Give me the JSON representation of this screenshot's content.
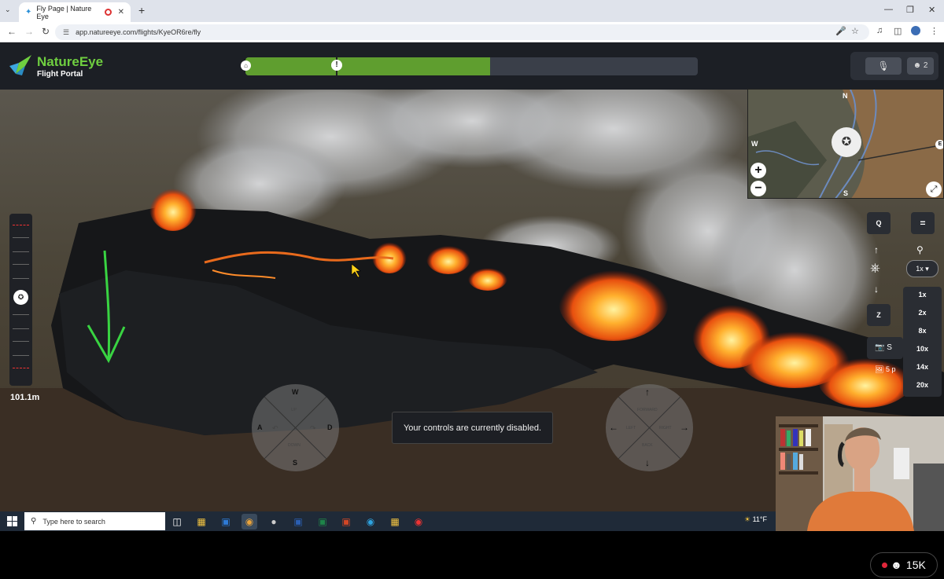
{
  "browser": {
    "tab_title": "Fly Page | Nature Eye",
    "url": "app.natureeye.com/flights/KyeOR6re/fly"
  },
  "header": {
    "brand": "NatureEye",
    "subtitle": "Flight Portal",
    "flight_progress": 0.54,
    "viewers_in_session": "2"
  },
  "flight": {
    "altitude": "101.1m",
    "controls_disabled_message": "Your controls are currently disabled."
  },
  "left_joystick": {
    "top": "W",
    "bottom": "S",
    "left": "A",
    "right": "D",
    "top_sub": "UP",
    "bottom_sub": "DOWN"
  },
  "right_joystick": {
    "top_sub": "FORWARD",
    "bottom_sub": "BACK",
    "left_sub": "LEFT",
    "right_sub": "RIGHT"
  },
  "minimap": {
    "north": "N",
    "south": "S",
    "east": "E",
    "west": "W",
    "zoom_in": "+",
    "zoom_out": "−"
  },
  "camera_controls": {
    "q_label": "Q",
    "menu_label": "=",
    "z_label": "Z",
    "zoom_current": "1x",
    "zoom_options": [
      "1x",
      "2x",
      "8x",
      "10x",
      "14x",
      "20x"
    ],
    "photo_label": "S",
    "gallery_label": "5 p"
  },
  "taskbar": {
    "search_placeholder": "Type here to search",
    "weather": "11°F"
  },
  "stream": {
    "viewer_count": "15K"
  },
  "colors": {
    "brand_green": "#6fcf40",
    "progress_green": "#5f9e2f",
    "header_bg": "#1c1f25",
    "live_red": "#e0263a"
  }
}
